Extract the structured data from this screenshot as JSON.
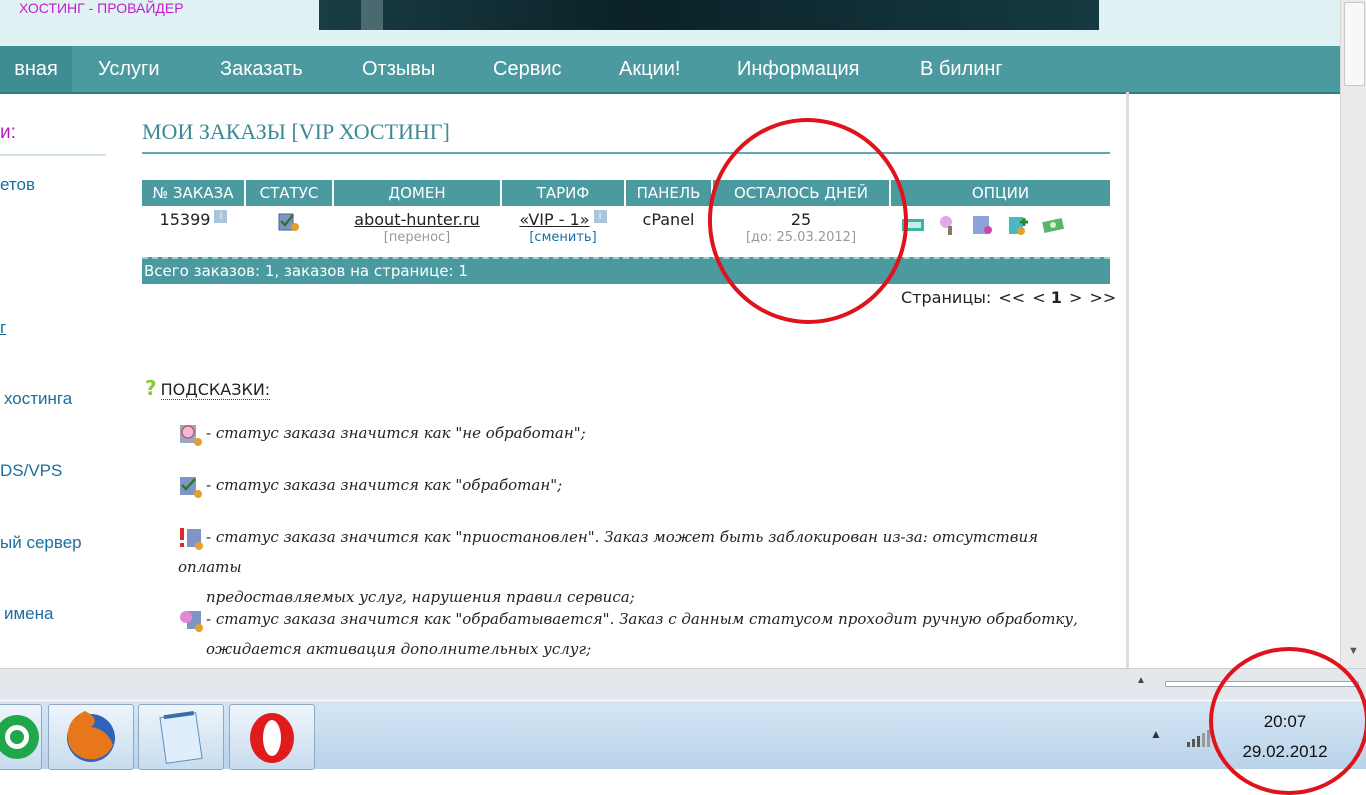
{
  "header": {
    "brand": "ХОСТИНГ - ПРОВАЙДЕР"
  },
  "nav": [
    "вная",
    "Услуги",
    "Заказать",
    "Отзывы",
    "Сервис",
    "Акции!",
    "Информация",
    "В билинг"
  ],
  "sidebar": [
    "и:",
    "етов",
    "г",
    "хостинга",
    "DS/VPS",
    "ый сервер",
    "имена"
  ],
  "page": {
    "title": "МОИ ЗАКАЗЫ [VIP ХОСТИНГ]"
  },
  "orders": {
    "columns": [
      "№ ЗАКАЗА",
      "СТАТУС",
      "ДОМЕН",
      "ТАРИФ",
      "ПАНЕЛЬ",
      "ОСТАЛОСЬ ДНЕЙ",
      "ОПЦИИ"
    ],
    "rows": [
      {
        "id": "15399",
        "domain": "about-hunter.ru",
        "domain_note": "[перенос]",
        "tariff": "«VIP - 1»",
        "tariff_action": "[сменить]",
        "panel": "cPanel",
        "days_left": "25",
        "until": "[до: 25.03.2012]"
      }
    ],
    "total": "Всего заказов: 1, заказов на странице: 1"
  },
  "pager": {
    "label": "Страницы:",
    "first": "<<",
    "prev": "<",
    "current": "1",
    "next": ">",
    "last": ">>"
  },
  "hints": {
    "title": "ПОДСКАЗКИ:",
    "items": [
      "- статус заказа значится как \"не обработан\";",
      "- статус заказа значится как \"обработан\";",
      "- статус заказа значится как \"приостановлен\". Заказ может быть заблокирован из-за: отсутствия оплаты",
      "предоставляемых услуг, нарушения правил сервиса;",
      "- статус заказа значится как \"обрабатывается\". Заказ с данным статусом проходит ручную обработку,",
      "ожидается активация дополнительных услуг;"
    ]
  },
  "clock": {
    "time": "20:07",
    "date": "29.02.2012"
  },
  "colors": {
    "nav": "#4a9aa0",
    "title": "#3b8a94",
    "link": "#1a6ea0",
    "annotation": "#e0131c"
  }
}
